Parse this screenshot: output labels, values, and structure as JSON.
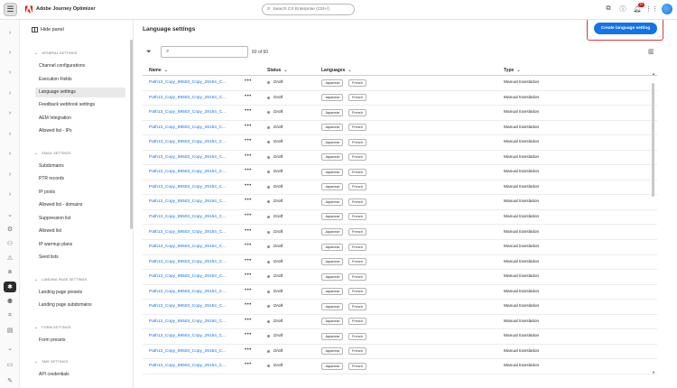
{
  "app": {
    "title": "Adobe Journey Optimizer",
    "search_placeholder": "Search CX Enterprise (Ctrl+/)",
    "notification_count": "9+",
    "icons": [
      "menu-icon",
      "adobe-logo-icon",
      "search-icon",
      "external-link-icon",
      "help-icon",
      "bell-icon",
      "apps-icon",
      "avatar"
    ]
  },
  "panel": {
    "hide_label": "Hide panel",
    "sections": [
      {
        "title": "GENERAL SETTINGS",
        "items": [
          "Channel configurations",
          "Execution Fields",
          "Language settings",
          "Feedback webhook settings",
          "AEM Integration",
          "Allowed list - IPs"
        ]
      },
      {
        "title": "EMAIL SETTINGS",
        "items": [
          "Subdomains",
          "PTR records",
          "IP pools",
          "Allowed list - domains",
          "Suppression list",
          "Allowed list",
          "IP warmup plans",
          "Seed lists"
        ]
      },
      {
        "title": "LANDING PAGE SETTINGS",
        "items": [
          "Landing page presets",
          "Landing page subdomains"
        ]
      },
      {
        "title": "FORM SETTINGS",
        "items": [
          "Form presets"
        ]
      },
      {
        "title": "SMS SETTINGS",
        "items": [
          "API credentials"
        ]
      }
    ],
    "selected_item": "Language settings"
  },
  "main": {
    "title": "Language settings",
    "create_button": "Create language setting",
    "count": "60 of 60",
    "columns": {
      "name": "Name",
      "status": "Status",
      "languages": "Languages",
      "type": "Type"
    },
    "rows": [
      {
        "name": "Path13_Copy_89503_Copy_29154_C...",
        "status": "Draft",
        "languages": [
          "Japanese",
          "French"
        ],
        "type": "Manual translation"
      },
      {
        "name": "Path13_Copy_89503_Copy_29154_C...",
        "status": "Draft",
        "languages": [
          "Japanese",
          "French"
        ],
        "type": "Manual translation"
      },
      {
        "name": "Path13_Copy_89503_Copy_29154_C...",
        "status": "Draft",
        "languages": [
          "Japanese",
          "French"
        ],
        "type": "Manual translation"
      },
      {
        "name": "Path13_Copy_89503_Copy_29154_C...",
        "status": "Draft",
        "languages": [
          "Japanese",
          "French"
        ],
        "type": "Manual translation"
      },
      {
        "name": "Path13_Copy_89503_Copy_29154_C...",
        "status": "Draft",
        "languages": [
          "Japanese",
          "French"
        ],
        "type": "Manual translation"
      },
      {
        "name": "Path13_Copy_89503_Copy_29154_C...",
        "status": "Draft",
        "languages": [
          "Japanese",
          "French"
        ],
        "type": "Manual translation"
      },
      {
        "name": "Path13_Copy_89503_Copy_29154_C...",
        "status": "Draft",
        "languages": [
          "Japanese",
          "French"
        ],
        "type": "Manual translation"
      },
      {
        "name": "Path13_Copy_89503_Copy_29154_C...",
        "status": "Draft",
        "languages": [
          "Japanese",
          "French"
        ],
        "type": "Manual translation"
      },
      {
        "name": "Path13_Copy_89503_Copy_29154_C...",
        "status": "Draft",
        "languages": [
          "Japanese",
          "French"
        ],
        "type": "Manual translation"
      },
      {
        "name": "Path13_Copy_89503_Copy_29154_C...",
        "status": "Draft",
        "languages": [
          "Japanese",
          "French"
        ],
        "type": "Manual translation"
      },
      {
        "name": "Path13_Copy_89503_Copy_29154_C...",
        "status": "Draft",
        "languages": [
          "Japanese",
          "French"
        ],
        "type": "Manual translation"
      },
      {
        "name": "Path13_Copy_89503_Copy_29154_C...",
        "status": "Draft",
        "languages": [
          "Japanese",
          "French"
        ],
        "type": "Manual translation"
      },
      {
        "name": "Path13_Copy_89503_Copy_29154_C...",
        "status": "Draft",
        "languages": [
          "Japanese",
          "French"
        ],
        "type": "Manual translation"
      },
      {
        "name": "Path13_Copy_89503_Copy_29154_C...",
        "status": "Draft",
        "languages": [
          "Japanese",
          "French"
        ],
        "type": "Manual translation"
      },
      {
        "name": "Path13_Copy_89503_Copy_29154_C...",
        "status": "Draft",
        "languages": [
          "Japanese",
          "French"
        ],
        "type": "Manual translation"
      },
      {
        "name": "Path13_Copy_89503_Copy_29154_C...",
        "status": "Draft",
        "languages": [
          "Japanese",
          "French"
        ],
        "type": "Manual translation"
      },
      {
        "name": "Path13_Copy_89503_Copy_29154_C...",
        "status": "Draft",
        "languages": [
          "Japanese",
          "French"
        ],
        "type": "Manual translation"
      },
      {
        "name": "Path13_Copy_89503_Copy_29154_C...",
        "status": "Draft",
        "languages": [
          "Japanese",
          "French"
        ],
        "type": "Manual translation"
      },
      {
        "name": "Path13_Copy_89503_Copy_29154_C...",
        "status": "Draft",
        "languages": [
          "Japanese",
          "French"
        ],
        "type": "Manual translation"
      },
      {
        "name": "Path13_Copy_89503_Copy_29154_C...",
        "status": "Draft",
        "languages": [
          "Japanese",
          "French"
        ],
        "type": "Manual translation"
      }
    ]
  },
  "colors": {
    "accent": "#1473e6",
    "highlight": "#d7373f",
    "draft_dot": "#8e8e8e"
  }
}
